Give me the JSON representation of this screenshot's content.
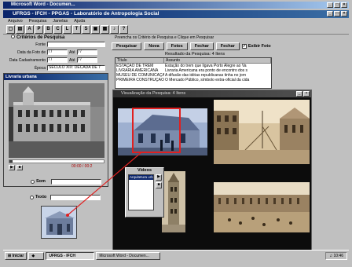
{
  "colors": {
    "title_bar": "#0a246a",
    "highlight_box": "#e02020",
    "selection": "#0a246a"
  },
  "outer_window": {
    "title": "Microsoft Word - Documen..."
  },
  "app": {
    "title": "UFRGS - IFCH - PPGAS - Laboratório de Antropologia Social",
    "menu": [
      "Arquivo",
      "Pesquisa",
      "Janelas",
      "Ajuda"
    ],
    "toolbar": [
      "A",
      "P",
      "B",
      "C",
      "L",
      "T",
      "S"
    ]
  },
  "criteria": {
    "title": "Critérios de Pesquisa",
    "fields": [
      {
        "label": "Fonte",
        "value": ""
      },
      {
        "label": "Data da Foto de",
        "value": "/ /",
        "to_label": "Até",
        "to_value": "/ /"
      },
      {
        "label": "Data Cadastramento",
        "value": "/ /",
        "to_label": "Até",
        "to_value": "/ /"
      },
      {
        "label": "Época",
        "value": "SÉCULO XIX: DÉCADA DE 7"
      }
    ]
  },
  "search": {
    "hint": "Preencha os Critério de Pesquisa e Clique em Pesquisar",
    "buttons": {
      "search": "Pesquisar",
      "new": "Nova",
      "photos": "Fotos",
      "close": "Fechar",
      "quit": "Fechar"
    },
    "show_photo_label": "Exibir Foto",
    "show_photo_checked": true
  },
  "results": {
    "label": "Resultado da Pesquisa:  4 Itens",
    "columns": [
      "Título",
      "Assunto"
    ],
    "rows": [
      [
        "ESTAÇÃO DE TREM",
        "Estação do trem que ligava Porto Alegre ao Va"
      ],
      [
        "LIVRARIA AMERICANA",
        "Livraria Americana era ponto de encontro dos s"
      ],
      [
        "MUSEU DE COMUNICAÇÃO",
        "A difusão das idéias republicanas tinha no jorn"
      ],
      [
        "PRIMEIRA CONSTRUÇÃO DE",
        "O Mercado Público, símbolo extra-oficial da cida"
      ]
    ]
  },
  "photo_window": {
    "title": "Livraria urbana",
    "time_readout": "00:00 / 00:2",
    "radio_sound": "Som",
    "radio_text": "Texto"
  },
  "viz_window": {
    "title": "Visualização da Pesquisa:  4 Itens"
  },
  "videos": {
    "title": "Vídeos",
    "items": [
      "Arquitetura urbana"
    ]
  },
  "taskbar": {
    "start": "Iniciar",
    "tasks": [
      "UFRGS - IFCH",
      "Microsoft Word - Documen..."
    ],
    "clock": "10:46"
  }
}
